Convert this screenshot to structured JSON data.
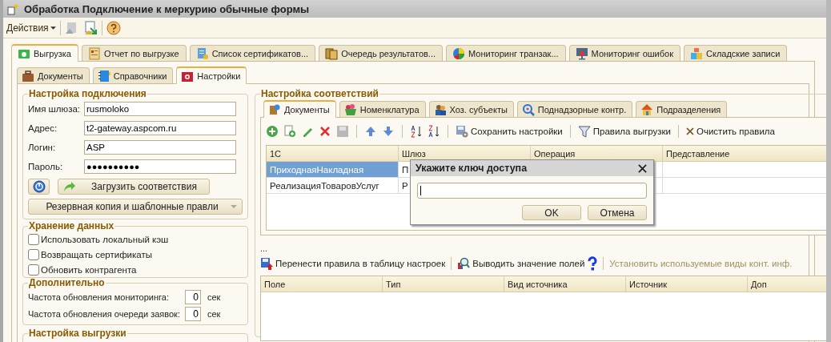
{
  "window": {
    "title": "Обработка  Подключение к меркурию обычные формы"
  },
  "toolbar": {
    "actions_menu": "Действия"
  },
  "main_tabs": [
    {
      "label": "Выгрузка",
      "selected": true
    },
    {
      "label": "Отчет по выгрузке",
      "selected": false
    },
    {
      "label": "Список сертификатов...",
      "selected": false
    },
    {
      "label": "Очередь результатов...",
      "selected": false
    },
    {
      "label": "Мониторинг транзак...",
      "selected": false
    },
    {
      "label": "Мониторинг ошибок",
      "selected": false
    },
    {
      "label": "Складские записи",
      "selected": false
    }
  ],
  "sub_tabs": [
    {
      "label": "Документы",
      "selected": false
    },
    {
      "label": "Справочники",
      "selected": false
    },
    {
      "label": "Настройки",
      "selected": true
    }
  ],
  "connection": {
    "title": "Настройка подключения",
    "fields": [
      {
        "label": "Имя шлюза:",
        "value": "rusmoloko",
        "kind": "text"
      },
      {
        "label": "Адрес:",
        "value": "t2-gateway.aspcom.ru",
        "kind": "text"
      },
      {
        "label": "Логин:",
        "value": "ASP",
        "kind": "text"
      },
      {
        "label": "Пароль:",
        "value": "●●●●●●●●●●",
        "kind": "password"
      }
    ],
    "load_button": "Загрузить соответствия",
    "backup_button": "Резервная копия и шаблонные правли"
  },
  "storage": {
    "title": "Хранение данных",
    "options": [
      {
        "label": "Использовать локальный кэш",
        "checked": false
      },
      {
        "label": "Возвращать сертификаты",
        "checked": false
      },
      {
        "label": "Обновить контрагента",
        "checked": false
      }
    ]
  },
  "extra": {
    "title": "Дополнительно",
    "rows": [
      {
        "label": "Частота обновления мониторинга:",
        "value": "0",
        "unit": "сек"
      },
      {
        "label": "Частота обновления очереди заявок:",
        "value": "0",
        "unit": "сек"
      }
    ]
  },
  "export_settings": {
    "title": "Настройка выгрузки"
  },
  "mapping": {
    "title": "Настройка соответствий",
    "tabs": [
      {
        "label": "Документы",
        "selected": true
      },
      {
        "label": "Номенклатура",
        "selected": false
      },
      {
        "label": "Хоз. субъекты",
        "selected": false
      },
      {
        "label": "Поднадзорные контр.",
        "selected": false
      },
      {
        "label": "Подразделения",
        "selected": false
      }
    ],
    "toolbar": [
      "Сохранить настройки",
      "Правила выгрузки",
      "Очистить правила"
    ],
    "table": {
      "columns": [
        "1С",
        "Шлюз",
        "Операция",
        "Представление"
      ],
      "rows": [
        {
          "cells": [
            "ПриходнаяНакладная",
            "П"
          ],
          "selected": true
        },
        {
          "cells": [
            "РеализацияТоваровУслуг",
            "Р"
          ],
          "selected": false
        }
      ]
    },
    "ellipsis": "...",
    "fields_toolbar": [
      {
        "label": "Перенести правила в таблицу настроек",
        "disabled": false
      },
      {
        "label": "Выводить значение полей",
        "disabled": false
      },
      {
        "label": "Установить используемые виды конт. инф.",
        "disabled": true
      }
    ],
    "fields_table": {
      "columns": [
        "Поле",
        "Тип",
        "Вид источника",
        "Источник",
        "Доп"
      ]
    }
  },
  "dialog": {
    "title": "Укажите ключ доступа",
    "ok": "OK",
    "cancel": "Отмена"
  }
}
